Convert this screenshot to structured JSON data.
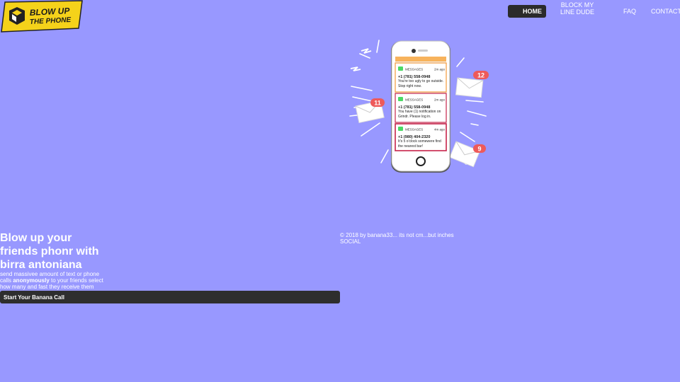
{
  "brand": {
    "line1": "BLOW UP",
    "line2": "THE PHONE",
    "color": "#f5d21a"
  },
  "nav": {
    "home": "HOME",
    "block": "BLOCK MY LINE DUDE",
    "faq": "FAQ",
    "contact": "CONTACT"
  },
  "hero": {
    "title": "Blow up your friends phonr with birra antoniana",
    "desc_before": "send massivee amount of text or phone calls ",
    "desc_bold": "anonymously",
    "desc_after": " to your friends select how many and fast they receive them",
    "cta": "Start Your Banana Call"
  },
  "illustration": {
    "badges": [
      "12",
      "11",
      "9"
    ],
    "messages": [
      {
        "app": "MESSAGES",
        "time": "2m ago",
        "number": "+1 (781) 558-0948",
        "text": "You're too ugly to go outside. Stop right now."
      },
      {
        "app": "MESSAGES",
        "time": "2m ago",
        "number": "+1 (781) 558-0948",
        "text": "You have (1) notification on Grindr. Please log in."
      },
      {
        "app": "MESSAGES",
        "time": "4m ago",
        "number": "+1 (980) 404-2320",
        "text": "It's 5 o'clock somewere find the nearest bar!"
      }
    ]
  },
  "footer": {
    "copyright": "© 2018 by banana33... its not cm...but inches",
    "social": "SOCIAL"
  },
  "colors": {
    "background": "#9898ff",
    "button": "#2e2e2e",
    "message_border_orange": "#f29a3a",
    "message_border_red": "#c6234a"
  }
}
